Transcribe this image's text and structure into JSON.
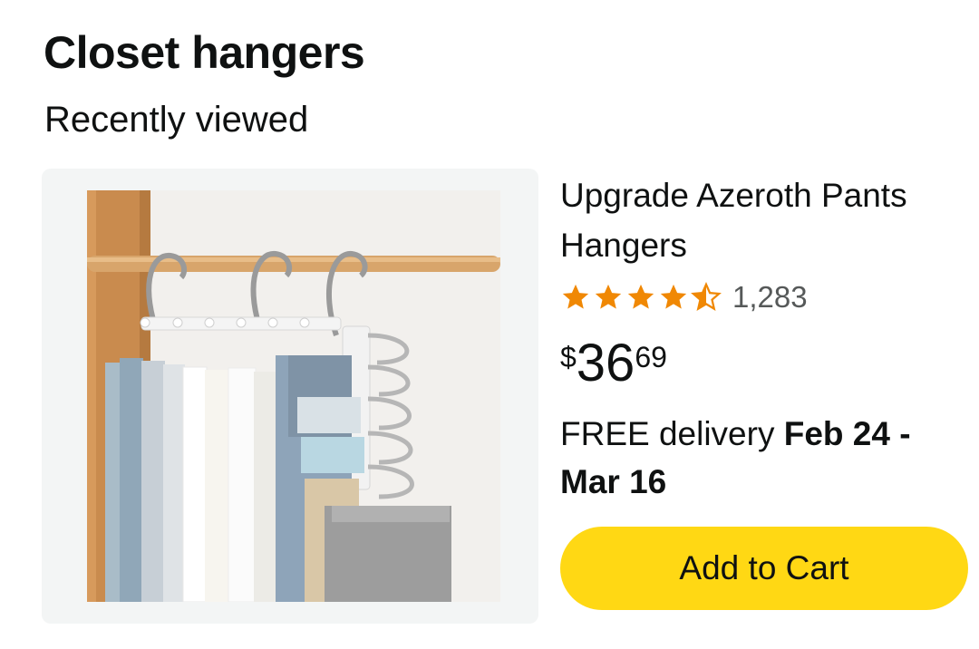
{
  "section": {
    "title": "Closet hangers",
    "subtitle": "Recently viewed"
  },
  "product": {
    "image_icon": "product-photo-pants-hangers",
    "title": "Upgrade Azeroth Pants Hangers",
    "rating": {
      "stars": 4.5,
      "max_stars": 5,
      "count": "1,283",
      "star_color": "#f08804"
    },
    "price": {
      "currency": "$",
      "whole": "36",
      "fraction": "69"
    },
    "delivery": {
      "prefix": "FREE delivery",
      "dates": "Feb 24 - Mar 16"
    },
    "add_to_cart": {
      "label": "Add to Cart",
      "color": "#ffd814"
    }
  }
}
